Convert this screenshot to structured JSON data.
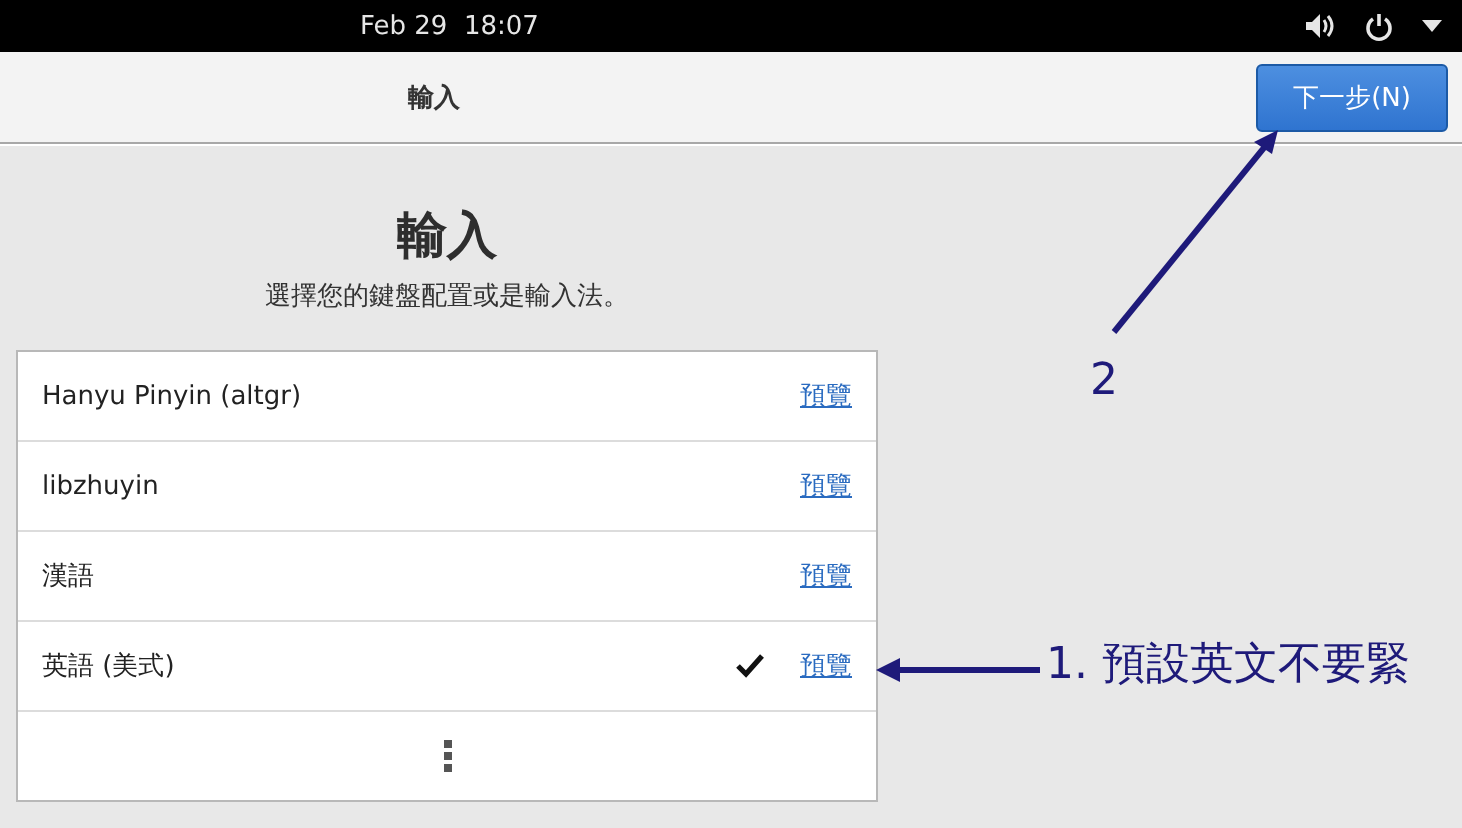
{
  "top_bar": {
    "clock": "Feb 29  18:07"
  },
  "header": {
    "title": "輸入",
    "next_button": "下一步(N)"
  },
  "page": {
    "heading": "輸入",
    "subtitle": "選擇您的鍵盤配置或是輸入法。"
  },
  "input_sources": [
    {
      "name": "Hanyu Pinyin (altgr)",
      "selected": false,
      "preview": "預覽"
    },
    {
      "name": "libzhuyin",
      "selected": false,
      "preview": "預覽"
    },
    {
      "name": "漢語",
      "selected": false,
      "preview": "預覽"
    },
    {
      "name": "英語 (美式)",
      "selected": true,
      "preview": "預覽"
    }
  ],
  "annotations": [
    {
      "kind": "diagonal",
      "label": "2"
    },
    {
      "kind": "left",
      "label": "1. 預設英文不要緊"
    }
  ]
}
